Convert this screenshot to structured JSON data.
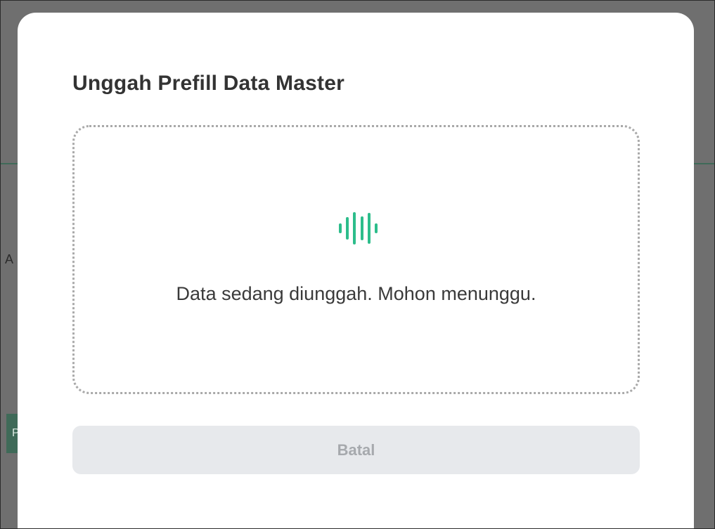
{
  "background": {
    "partial_text": "A",
    "chip_text": "P"
  },
  "modal": {
    "title": "Unggah Prefill Data Master",
    "upload_area": {
      "loader_icon": "audio-wave-loader-icon",
      "status_text": "Data sedang diunggah. Mohon menunggu."
    },
    "cancel_button": {
      "label": "Batal",
      "disabled": true
    }
  },
  "colors": {
    "overlay": "#6f6f6f",
    "accent_green": "#2dbd8b",
    "button_bg": "#e7e9ec",
    "button_text": "#a6a9ad"
  }
}
